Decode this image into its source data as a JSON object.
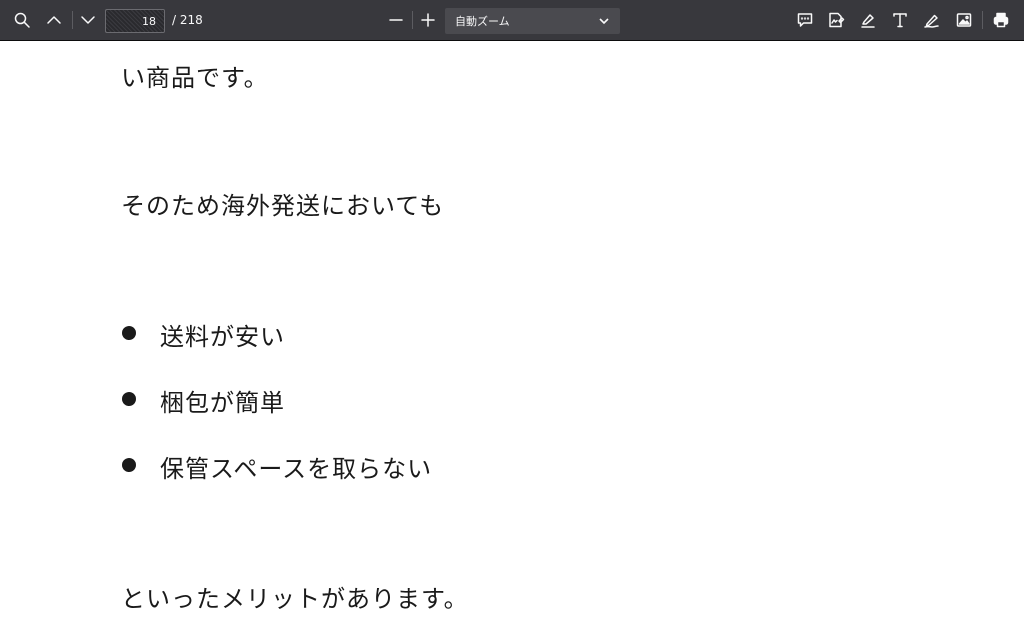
{
  "toolbar": {
    "page_current": "18",
    "page_total": "/ 218",
    "zoom_label": "自動ズーム",
    "icons": [
      "search-icon",
      "chevron-up-icon",
      "chevron-down-icon",
      "zoom-out-icon",
      "zoom-in-icon",
      "comment-icon",
      "signature-icon",
      "highlight-icon",
      "text-icon",
      "draw-icon",
      "image-icon",
      "print-icon"
    ]
  },
  "document": {
    "line_top": "い商品です。",
    "line_intro": "そのため海外発送においても",
    "bullets": [
      "送料が安い",
      "梱包が簡単",
      "保管スペースを取らない"
    ],
    "line_conclusion": "といったメリットがあります。"
  }
}
